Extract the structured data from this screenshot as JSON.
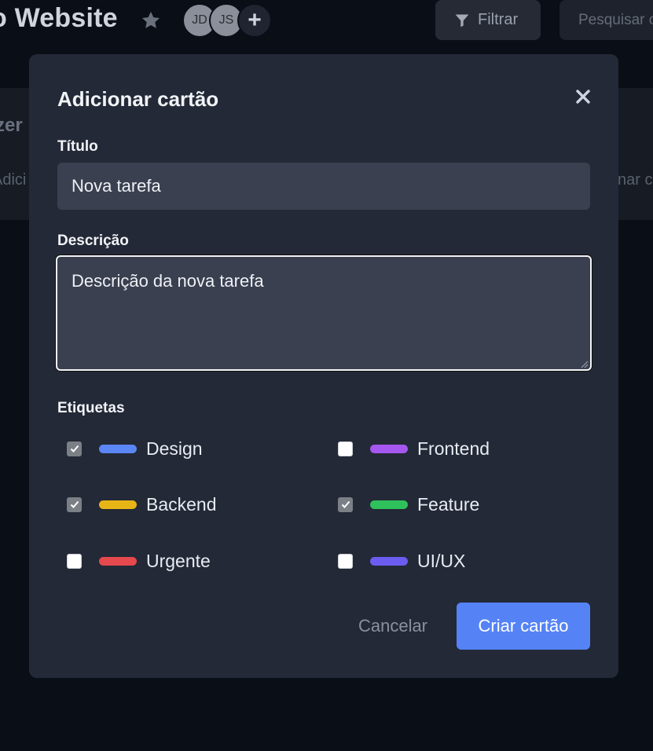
{
  "board": {
    "title": "o Website",
    "avatars": [
      "JD",
      "JS"
    ],
    "add_member": "+",
    "filter_label": "Filtrar",
    "search_placeholder": "Pesquisar c",
    "bg_column_title": "zer",
    "bg_add_left": "Adici",
    "bg_add_right": "nar c"
  },
  "modal": {
    "title": "Adicionar cartão",
    "title_field": {
      "label": "Título",
      "value": "Nova tarefa"
    },
    "description_field": {
      "label": "Descrição",
      "value": "Descrição da nova tarefa"
    },
    "tags_label": "Etiquetas",
    "tags": [
      {
        "label": "Design",
        "checked": true,
        "color": "#5b86f5"
      },
      {
        "label": "Frontend",
        "checked": false,
        "color": "#a557f0"
      },
      {
        "label": "Backend",
        "checked": true,
        "color": "#e8b517"
      },
      {
        "label": "Feature",
        "checked": true,
        "color": "#2fc15b"
      },
      {
        "label": "Urgente",
        "checked": false,
        "color": "#e5484d"
      },
      {
        "label": "UI/UX",
        "checked": false,
        "color": "#6a5df0"
      }
    ],
    "cancel_label": "Cancelar",
    "create_label": "Criar cartão"
  },
  "colors": {
    "accent": "#5583f6",
    "modal_bg": "#232936",
    "input_bg": "#3a4050"
  }
}
